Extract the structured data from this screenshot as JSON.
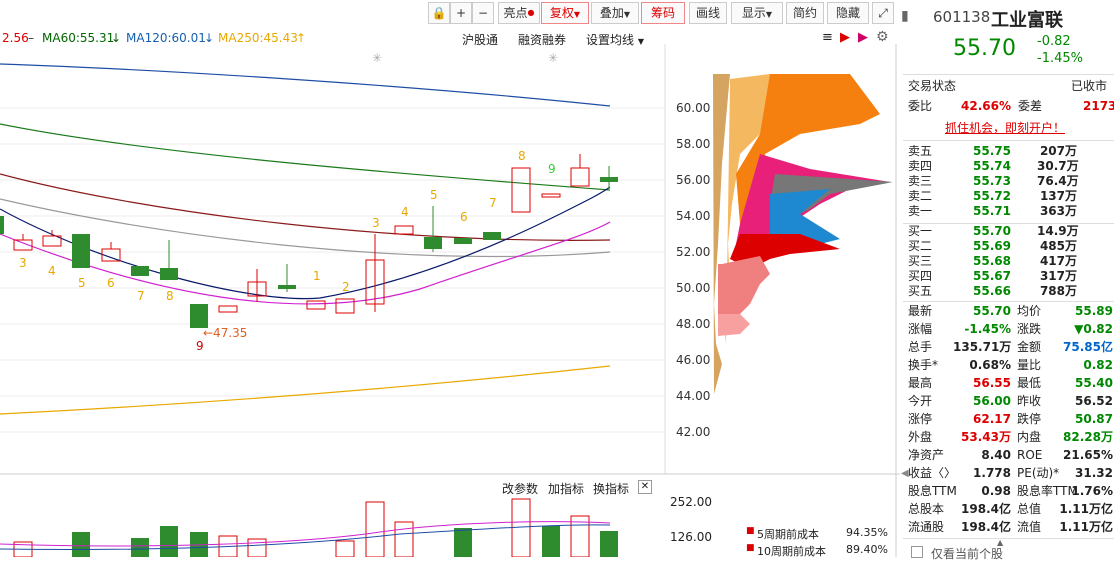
{
  "toolbar": {
    "lock": "🔒",
    "plus": "+",
    "minus": "−",
    "highlight": "亮点",
    "fuquan": "复权",
    "overlay": "叠加",
    "chips": "筹码",
    "draw": "画线",
    "display": "显示",
    "simple": "简约",
    "hide": "隐藏",
    "expand": "⤢"
  },
  "ma_legend": {
    "ma_first": "2.56",
    "ma60": "MA60:55.31",
    "ma120": "MA120:60.01",
    "ma250": "MA250:45.43",
    "down": "↓",
    "up": "↑",
    "dash": "–"
  },
  "links": {
    "hgt": "沪股通",
    "margin": "融资融券",
    "setma": "设置均线"
  },
  "price_ticks": [
    "60.00",
    "58.00",
    "56.00",
    "54.00",
    "52.00",
    "50.00",
    "48.00",
    "46.00",
    "44.00",
    "42.00"
  ],
  "annotations": {
    "low": "←47.35",
    "nine": "9"
  },
  "td_numbers": [
    "3",
    "4",
    "5",
    "6",
    "7",
    "8",
    "1",
    "2",
    "3",
    "4",
    "5",
    "6",
    "7",
    "8",
    "9",
    "9"
  ],
  "vol": {
    "params": "改参数",
    "add": "加指标",
    "switch": "换指标",
    "close": "✕",
    "tick_high": "252.00",
    "tick_low": "126.00"
  },
  "cost": {
    "label5": "5周期前成本",
    "val5": "94.35%",
    "label10": "10周期前成本",
    "val10": "89.40%"
  },
  "stock": {
    "code": "601138",
    "name": "工业富联",
    "price": "55.70",
    "change": "-0.82",
    "pct": "-1.45%"
  },
  "status": {
    "label": "交易状态",
    "value": "已收市"
  },
  "weibi": {
    "l1": "委比",
    "v1": "42.66%",
    "l2": "委差",
    "v2": "2173"
  },
  "promo": "抓住机会，即刻开户！",
  "sell": [
    {
      "label": "卖五",
      "price": "55.75",
      "vol": "207万"
    },
    {
      "label": "卖四",
      "price": "55.74",
      "vol": "30.7万"
    },
    {
      "label": "卖三",
      "price": "55.73",
      "vol": "76.4万"
    },
    {
      "label": "卖二",
      "price": "55.72",
      "vol": "137万"
    },
    {
      "label": "卖一",
      "price": "55.71",
      "vol": "363万"
    }
  ],
  "buy": [
    {
      "label": "买一",
      "price": "55.70",
      "vol": "14.9万"
    },
    {
      "label": "买二",
      "price": "55.69",
      "vol": "485万"
    },
    {
      "label": "买三",
      "price": "55.68",
      "vol": "417万"
    },
    {
      "label": "买四",
      "price": "55.67",
      "vol": "317万"
    },
    {
      "label": "买五",
      "price": "55.66",
      "vol": "788万"
    }
  ],
  "stats": [
    {
      "l1": "最新",
      "v1": "55.70",
      "c1": "g",
      "l2": "均价",
      "v2": "55.89",
      "c2": "g"
    },
    {
      "l1": "涨幅",
      "v1": "-1.45%",
      "c1": "g",
      "l2": "涨跌",
      "v2": "▼0.82",
      "c2": "g"
    },
    {
      "l1": "总手",
      "v1": "135.71万",
      "c1": "k",
      "l2": "金额",
      "v2": "75.85亿",
      "c2": "b"
    },
    {
      "l1": "换手*",
      "v1": "0.68%",
      "c1": "k",
      "l2": "量比",
      "v2": "0.82",
      "c2": "g"
    },
    {
      "l1": "最高",
      "v1": "56.55",
      "c1": "r",
      "l2": "最低",
      "v2": "55.40",
      "c2": "g"
    },
    {
      "l1": "今开",
      "v1": "56.00",
      "c1": "g",
      "l2": "昨收",
      "v2": "56.52",
      "c2": "k"
    },
    {
      "l1": "涨停",
      "v1": "62.17",
      "c1": "r",
      "l2": "跌停",
      "v2": "50.87",
      "c2": "g"
    },
    {
      "l1": "外盘",
      "v1": "53.43万",
      "c1": "r",
      "l2": "内盘",
      "v2": "82.28万",
      "c2": "g"
    },
    {
      "l1": "净资产",
      "v1": "8.40",
      "c1": "k",
      "l2": "ROE",
      "v2": "21.65%",
      "c2": "k"
    },
    {
      "l1": "收益〈〉",
      "v1": "1.778",
      "c1": "k",
      "l2": "PE(动)*",
      "v2": "31.32",
      "c2": "k"
    },
    {
      "l1": "股息TTM",
      "v1": "0.98",
      "c1": "k",
      "l2": "股息率TTM",
      "v2": "1.76%",
      "c2": "k"
    },
    {
      "l1": "总股本",
      "v1": "198.4亿",
      "c1": "k",
      "l2": "总值",
      "v2": "1.11万亿",
      "c2": "k"
    },
    {
      "l1": "流通股",
      "v1": "198.4亿",
      "c1": "k",
      "l2": "流值",
      "v2": "1.11万亿",
      "c2": "k"
    }
  ],
  "footer": {
    "checkbox_label": "仅看当前个股"
  }
}
